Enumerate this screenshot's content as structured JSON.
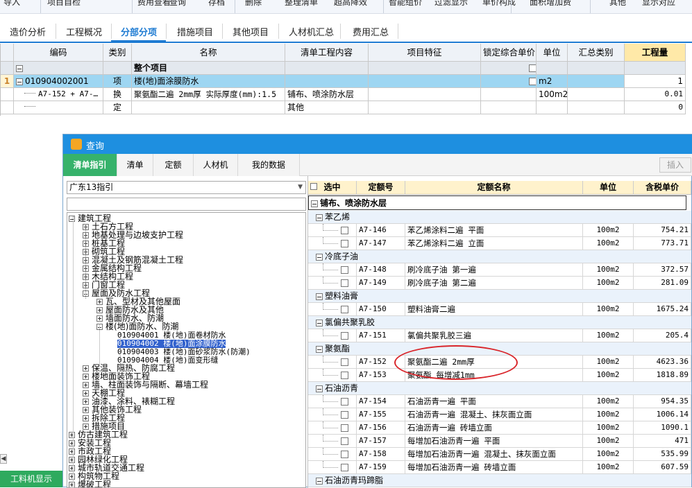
{
  "ribbon": {
    "items": [
      "导入",
      "项目自检",
      "费用查看",
      "查询",
      "存档",
      "删除",
      "整理清单",
      "超高降效",
      "智能组价",
      "过滤显示",
      "单价构成",
      "面积增加费",
      "其他",
      "显示对应"
    ]
  },
  "tabs": [
    "造价分析",
    "工程概况",
    "分部分项",
    "措施项目",
    "其他项目",
    "人材机汇总",
    "费用汇总"
  ],
  "active_tab": "分部分项",
  "grid": {
    "headers": [
      "编码",
      "类别",
      "名称",
      "清单工程内容",
      "项目特征",
      "锁定综合单价",
      "单位",
      "汇总类别",
      "工程量"
    ],
    "rows": [
      {
        "num": "",
        "code": "",
        "type": "",
        "name": "整个项目",
        "content": "",
        "feature": "",
        "unit": "",
        "category": "",
        "qty": ""
      },
      {
        "num": "1",
        "code": "010904002001",
        "type": "项",
        "name": "楼(地)面涂膜防水",
        "content": "",
        "feature": "",
        "unit": "m2",
        "category": "",
        "qty": "1"
      },
      {
        "num": "",
        "code": "A7-152 + A7-…",
        "type": "换",
        "name": "聚氨酯二遍 2mm厚  实际厚度(mm):1.5",
        "content": "铺布、喷涂防水层",
        "feature": "",
        "unit": "100m2",
        "category": "",
        "qty": "0.01"
      },
      {
        "num": "",
        "code": "",
        "type": "定",
        "name": "",
        "content": "其他",
        "feature": "",
        "unit": "",
        "category": "",
        "qty": "0"
      }
    ]
  },
  "dialog": {
    "title": "查询",
    "tabs": [
      "清单指引",
      "清单",
      "定额",
      "人材机",
      "我的数据"
    ],
    "insert_button": "插入",
    "region": "广东13指引",
    "tree": [
      "建筑工程",
      "土石方工程",
      "地基处理与边坡支护工程",
      "桩基工程",
      "砌筑工程",
      "混凝土及钢筋混凝土工程",
      "金属结构工程",
      "木结构工程",
      "门窗工程",
      "屋面及防水工程",
      "瓦、型材及其他屋面",
      "屋面防水及其他",
      "墙面防水、防潮",
      "楼(地)面防水、防潮",
      "010904001   楼(地)面卷材防水",
      "010904002   楼(地)面涂膜防水",
      "010904003   楼(地)面砂浆防水(防潮)",
      "010904004   楼(地)面变形缝",
      "保温、隔热、防腐工程",
      "楼地面装饰工程",
      "墙、柱面装饰与隔断、幕墙工程",
      "天棚工程",
      "油漆、涂料、裱糊工程",
      "其他装饰工程",
      "拆除工程",
      "措施项目",
      "仿古建筑工程",
      "安装工程",
      "市政工程",
      "园林绿化工程",
      "城市轨道交通工程",
      "构筑物工程",
      "爆破工程"
    ],
    "result_headers": [
      "选中",
      "定额号",
      "定额名称",
      "单位",
      "含税单价"
    ],
    "section": "铺布、喷涂防水层",
    "groups": [
      {
        "name": "苯乙烯",
        "items": [
          {
            "code": "A7-146",
            "name": "苯乙烯涂料二遍 平面",
            "unit": "100m2",
            "price": "754.21"
          },
          {
            "code": "A7-147",
            "name": "苯乙烯涂料二遍 立面",
            "unit": "100m2",
            "price": "773.71"
          }
        ]
      },
      {
        "name": "冷底子油",
        "items": [
          {
            "code": "A7-148",
            "name": "刷冷底子油 第一遍",
            "unit": "100m2",
            "price": "372.57"
          },
          {
            "code": "A7-149",
            "name": "刷冷底子油 第二遍",
            "unit": "100m2",
            "price": "281.09"
          }
        ]
      },
      {
        "name": "塑料油膏",
        "items": [
          {
            "code": "A7-150",
            "name": "塑料油膏二遍",
            "unit": "100m2",
            "price": "1675.24"
          }
        ]
      },
      {
        "name": "氯偏共聚乳胶",
        "items": [
          {
            "code": "A7-151",
            "name": "氯偏共聚乳胶三遍",
            "unit": "100m2",
            "price": "205.4"
          }
        ]
      },
      {
        "name": "聚氨酯",
        "items": [
          {
            "code": "A7-152",
            "name": "聚氨酯二遍 2mm厚",
            "unit": "100m2",
            "price": "4623.36"
          },
          {
            "code": "A7-153",
            "name": "聚氨酯 每增减1mm",
            "unit": "100m2",
            "price": "1818.89"
          }
        ]
      },
      {
        "name": "石油沥青",
        "items": [
          {
            "code": "A7-154",
            "name": "石油沥青一遍 平面",
            "unit": "100m2",
            "price": "954.35"
          },
          {
            "code": "A7-155",
            "name": "石油沥青一遍 混凝土、抹灰面立面",
            "unit": "100m2",
            "price": "1006.14"
          },
          {
            "code": "A7-156",
            "name": "石油沥青一遍 砖墙立面",
            "unit": "100m2",
            "price": "1090.1"
          },
          {
            "code": "A7-157",
            "name": "每增加石油沥青一遍 平面",
            "unit": "100m2",
            "price": "471"
          },
          {
            "code": "A7-158",
            "name": "每增加石油沥青一遍 混凝土、抹灰面立面",
            "unit": "100m2",
            "price": "535.99"
          },
          {
            "code": "A7-159",
            "name": "每增加石油沥青一遍 砖墙立面",
            "unit": "100m2",
            "price": "607.59"
          }
        ]
      },
      {
        "name": "石油沥青玛蹄脂",
        "items": []
      }
    ]
  },
  "bottom_left_button": "工料机显示",
  "colors": {
    "accent_blue": "#1e7bd2",
    "selected_row": "#9ed6f2",
    "dialog_title": "#1e8fe0",
    "green_tab": "#36b26b",
    "highlight_red": "#d9252a"
  }
}
